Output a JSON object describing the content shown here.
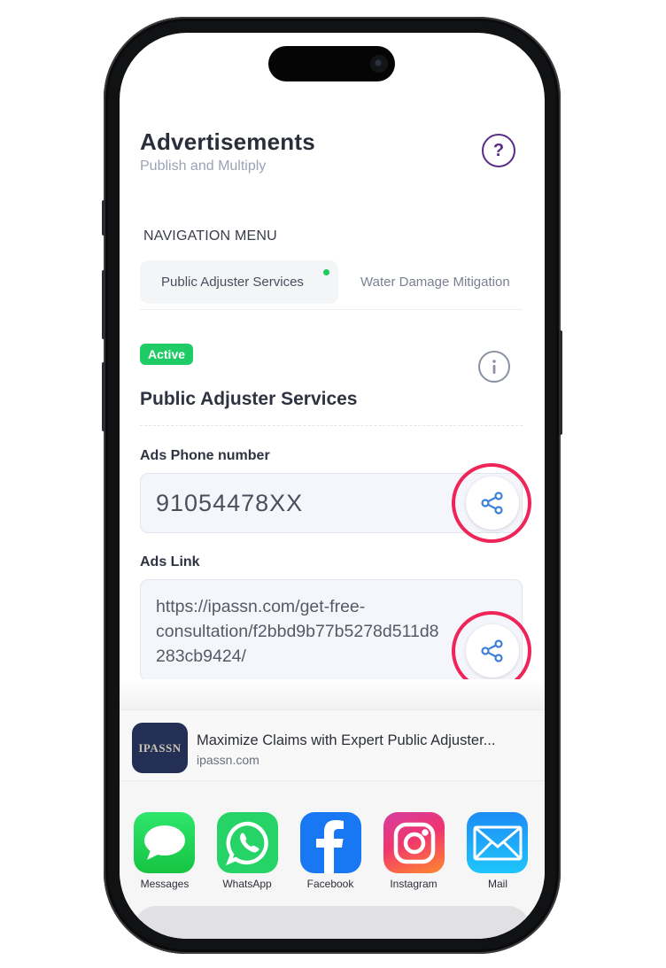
{
  "header": {
    "title": "Advertisements",
    "subtitle": "Publish and Multiply",
    "help_icon": "question-circle-icon"
  },
  "navigation": {
    "title": "NAVIGATION MENU",
    "tabs": [
      {
        "label": "Public Adjuster Services",
        "active": true,
        "status_dot": "#1ECB5C"
      },
      {
        "label": "Water Damage Mitigation",
        "active": false
      }
    ]
  },
  "service": {
    "badge": "Active",
    "badge_color": "#1ECB64",
    "title": "Public Adjuster Services",
    "info_icon": "info-circle-icon"
  },
  "fields": {
    "phone": {
      "label": "Ads Phone number",
      "value": "91054478XX",
      "action_icon": "share-icon"
    },
    "link": {
      "label": "Ads Link",
      "value_lines": [
        "https://ipassn.com/get-free-",
        "consultation/f2bbd9b77b5278d511d8",
        "283cb9424/"
      ],
      "action_icon": "share-icon"
    }
  },
  "highlight_color": "#EF2459",
  "share_sheet": {
    "preview": {
      "thumb_text": "IPASSN",
      "title": "Maximize Claims with Expert Public Adjuster...",
      "domain": "ipassn.com"
    },
    "apps": [
      {
        "label": "Messages",
        "icon": "messages-icon",
        "color": "#1FD35B"
      },
      {
        "label": "WhatsApp",
        "icon": "whatsapp-icon",
        "color": "#25D366"
      },
      {
        "label": "Facebook",
        "icon": "facebook-icon",
        "color": "#1877F2"
      },
      {
        "label": "Instagram",
        "icon": "instagram-icon",
        "color": "#E1306C"
      },
      {
        "label": "Mail",
        "icon": "mail-icon",
        "color": "#1E9BF7"
      }
    ]
  }
}
